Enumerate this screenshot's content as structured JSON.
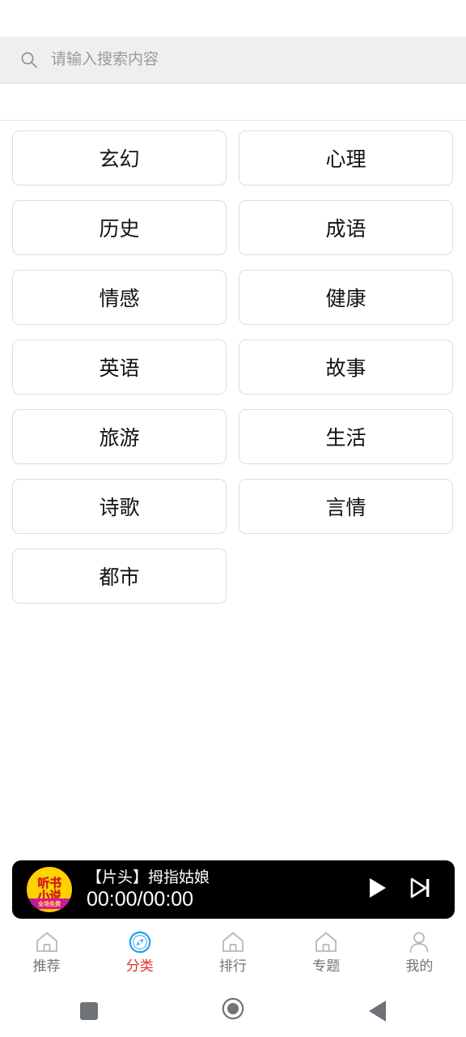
{
  "search": {
    "placeholder": "请输入搜索内容",
    "value": "",
    "icon": "search-icon"
  },
  "categories": {
    "items": [
      {
        "label": "玄幻"
      },
      {
        "label": "心理"
      },
      {
        "label": "历史"
      },
      {
        "label": "成语"
      },
      {
        "label": "情感"
      },
      {
        "label": "健康"
      },
      {
        "label": "英语"
      },
      {
        "label": "故事"
      },
      {
        "label": "旅游"
      },
      {
        "label": "生活"
      },
      {
        "label": "诗歌"
      },
      {
        "label": "言情"
      },
      {
        "label": "都市"
      }
    ]
  },
  "player": {
    "album_art": {
      "line1": "听书",
      "line2": "小说",
      "ribbon": "全场免费",
      "bg_color": "#ffd000",
      "text_color": "#d51a1a",
      "ribbon_color": "#d2179e"
    },
    "track_title": "【片头】拇指姑娘",
    "time": "00:00/00:00",
    "play_icon": "play-icon",
    "next_icon": "next-track-icon",
    "background": "#000000"
  },
  "tabs": {
    "active_color": "#e2302b",
    "inactive_color": "#6e7378",
    "items": [
      {
        "label": "推荐",
        "icon": "home-icon",
        "active": false
      },
      {
        "label": "分类",
        "icon": "compass-icon",
        "active": true
      },
      {
        "label": "排行",
        "icon": "home-icon",
        "active": false
      },
      {
        "label": "专题",
        "icon": "home-icon",
        "active": false
      },
      {
        "label": "我的",
        "icon": "person-icon",
        "active": false
      }
    ]
  },
  "system_nav": {
    "recents_icon": "square-recents-icon",
    "home_icon": "circle-home-icon",
    "back_icon": "triangle-back-icon"
  }
}
